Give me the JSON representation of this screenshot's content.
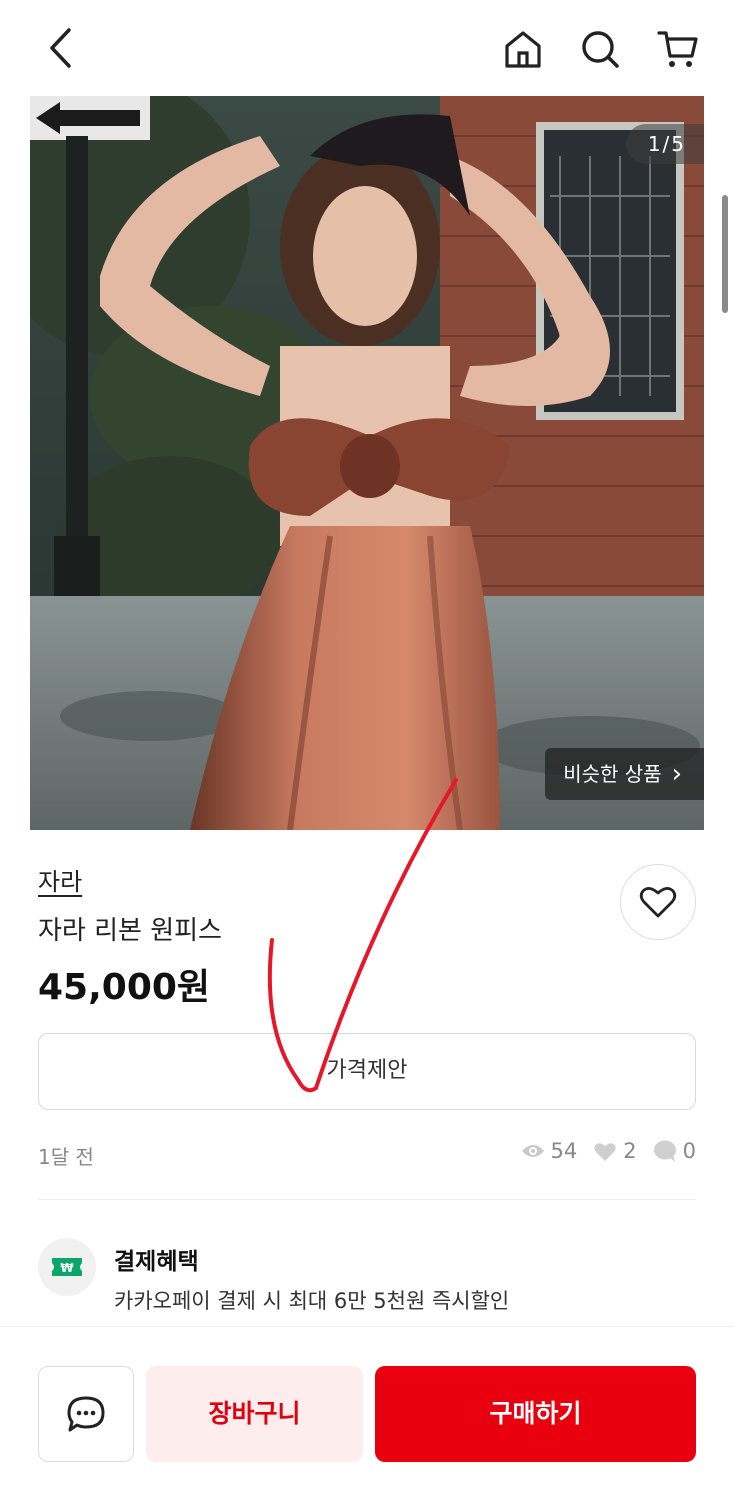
{
  "header": {
    "back_icon": "chevron-left-icon",
    "home_icon": "home-icon",
    "search_icon": "search-icon",
    "cart_icon": "cart-icon"
  },
  "gallery": {
    "counter": "1/5",
    "similar_label": "비슷한 상품",
    "similar_chevron": "›"
  },
  "product": {
    "brand": "자라",
    "title": "자라 리본 원피스",
    "price": "45,000원",
    "like_icon": "heart-outline-icon"
  },
  "offer": {
    "label": "가격제안"
  },
  "meta": {
    "time": "1달 전",
    "views": "54",
    "likes": "2",
    "chats": "0"
  },
  "benefit": {
    "title": "결제혜택",
    "description": "카카오페이 결제 시 최대 6만 5천원 즉시할인",
    "icon": "won-ticket-icon",
    "icon_color": "#0aa66b"
  },
  "bottom": {
    "chat_icon": "chat-bubble-icon",
    "cart_label": "장바구니",
    "buy_label": "구매하기"
  },
  "colors": {
    "accent": "#e8000f",
    "accent_light": "#fdeeed",
    "annotation": "#e5182a"
  }
}
